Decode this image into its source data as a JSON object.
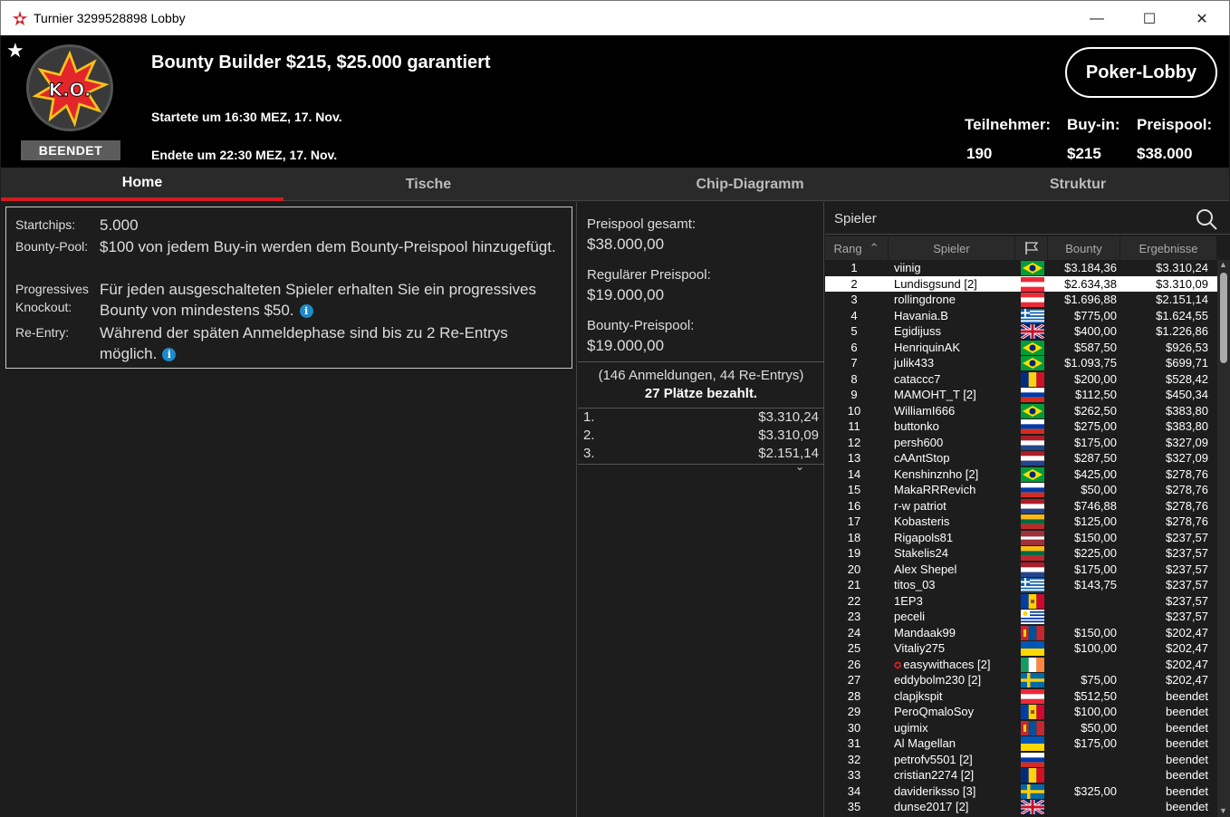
{
  "window": {
    "title": "Turnier 3299528898 Lobby",
    "min": "—",
    "max": "☐",
    "close": "✕"
  },
  "header": {
    "status": "BEENDET",
    "name": "Bounty Builder $215, $25.000 garantiert",
    "start": "Startete um 16:30 MEZ, 17. Nov.",
    "end": "Endete um 22:30 MEZ, 17. Nov.",
    "lobby_button": "Poker-Lobby",
    "stats": [
      {
        "label": "Teilnehmer:",
        "value": "190"
      },
      {
        "label": "Buy-in:",
        "value": "$215"
      },
      {
        "label": "Preispool:",
        "value": "$38.000"
      }
    ]
  },
  "tabs": [
    {
      "label": "Home",
      "active": true
    },
    {
      "label": "Tische",
      "active": false
    },
    {
      "label": "Chip-Diagramm",
      "active": false
    },
    {
      "label": "Struktur",
      "active": false
    }
  ],
  "info": {
    "startchips_key": "Startchips:",
    "startchips_val": "5.000",
    "bounty_key": "Bounty-Pool:",
    "bounty_val": "$100 von jedem Buy-in werden dem Bounty-Preispool hinzugefügt.",
    "pko_key1": "Progressives",
    "pko_key2": "Knockout:",
    "pko_val": "Für jeden ausgeschalteten Spieler erhalten Sie ein progressives Bounty von mindestens $50.",
    "reentry_key": "Re-Entry:",
    "reentry_val": "Während der späten Anmeldephase sind bis zu 2 Re-Entrys möglich.",
    "info_glyph": "i"
  },
  "prize": {
    "total_label": "Preispool gesamt:",
    "total_value": "$38.000,00",
    "regular_label": "Regulärer Preispool:",
    "regular_value": "$19.000,00",
    "bounty_label": "Bounty-Preispool:",
    "bounty_value": "$19.000,00",
    "registrations": "(146 Anmeldungen, 44 Re-Entrys)",
    "paid": "27 Plätze bezahlt.",
    "payouts": [
      {
        "place": "1.",
        "amount": "$3.310,24"
      },
      {
        "place": "2.",
        "amount": "$3.310,09"
      },
      {
        "place": "3.",
        "amount": "$2.151,14"
      }
    ]
  },
  "players": {
    "title": "Spieler",
    "columns": {
      "rank": "Rang",
      "player": "Spieler",
      "bounty": "Bounty",
      "result": "Ergebnisse"
    },
    "rows": [
      {
        "rank": "1",
        "name": "viinig",
        "flag": "br",
        "bounty": "$3.184,36",
        "result": "$3.310,24"
      },
      {
        "rank": "2",
        "name": "Lundisgsund [2]",
        "flag": "at",
        "bounty": "$2.634,38",
        "result": "$3.310,09",
        "selected": true
      },
      {
        "rank": "3",
        "name": "rollingdrone",
        "flag": "at",
        "bounty": "$1.696,88",
        "result": "$2.151,14"
      },
      {
        "rank": "4",
        "name": "Havania.B",
        "flag": "gr",
        "bounty": "$775,00",
        "result": "$1.624,55"
      },
      {
        "rank": "5",
        "name": "Egidijuss",
        "flag": "uk",
        "bounty": "$400,00",
        "result": "$1.226,86"
      },
      {
        "rank": "6",
        "name": "HenriquinAK",
        "flag": "br",
        "bounty": "$587,50",
        "result": "$926,53"
      },
      {
        "rank": "7",
        "name": "julik433",
        "flag": "br",
        "bounty": "$1.093,75",
        "result": "$699,71"
      },
      {
        "rank": "8",
        "name": "cataccc7",
        "flag": "ro",
        "bounty": "$200,00",
        "result": "$528,42"
      },
      {
        "rank": "9",
        "name": "MAMOHT_T [2]",
        "flag": "ru",
        "bounty": "$112,50",
        "result": "$450,34"
      },
      {
        "rank": "10",
        "name": "WilliamI666",
        "flag": "br",
        "bounty": "$262,50",
        "result": "$383,80"
      },
      {
        "rank": "11",
        "name": "buttonko",
        "flag": "ru",
        "bounty": "$275,00",
        "result": "$383,80"
      },
      {
        "rank": "12",
        "name": "persh600",
        "flag": "nl",
        "bounty": "$175,00",
        "result": "$327,09"
      },
      {
        "rank": "13",
        "name": "cAAntStop",
        "flag": "nl",
        "bounty": "$287,50",
        "result": "$327,09"
      },
      {
        "rank": "14",
        "name": "Kenshinznho [2]",
        "flag": "br",
        "bounty": "$425,00",
        "result": "$278,76"
      },
      {
        "rank": "15",
        "name": "MakaRRRevich",
        "flag": "ru",
        "bounty": "$50,00",
        "result": "$278,76"
      },
      {
        "rank": "16",
        "name": "r-w patriot",
        "flag": "nl",
        "bounty": "$746,88",
        "result": "$278,76"
      },
      {
        "rank": "17",
        "name": "Kobasteris",
        "flag": "lt",
        "bounty": "$125,00",
        "result": "$278,76"
      },
      {
        "rank": "18",
        "name": "Rigapols81",
        "flag": "lv",
        "bounty": "$150,00",
        "result": "$237,57"
      },
      {
        "rank": "19",
        "name": "Stakelis24",
        "flag": "lt",
        "bounty": "$225,00",
        "result": "$237,57"
      },
      {
        "rank": "20",
        "name": "Alex Shepel",
        "flag": "nl",
        "bounty": "$175,00",
        "result": "$237,57"
      },
      {
        "rank": "21",
        "name": "titos_03",
        "flag": "gr",
        "bounty": "$143,75",
        "result": "$237,57"
      },
      {
        "rank": "22",
        "name": "1EP3",
        "flag": "md",
        "bounty": "",
        "result": "$237,57"
      },
      {
        "rank": "23",
        "name": "peceli",
        "flag": "uy",
        "bounty": "",
        "result": "$237,57"
      },
      {
        "rank": "24",
        "name": "Mandaak99",
        "flag": "mn",
        "bounty": "$150,00",
        "result": "$202,47"
      },
      {
        "rank": "25",
        "name": "Vitaliy275",
        "flag": "ua",
        "bounty": "$100,00",
        "result": "$202,47"
      },
      {
        "rank": "26",
        "name": "easywithaces [2]",
        "flag": "ie",
        "bounty": "",
        "result": "$202,47",
        "star": true
      },
      {
        "rank": "27",
        "name": "eddybolm230 [2]",
        "flag": "se",
        "bounty": "$75,00",
        "result": "$202,47"
      },
      {
        "rank": "28",
        "name": "clapjkspit",
        "flag": "at",
        "bounty": "$512,50",
        "result": "beendet"
      },
      {
        "rank": "29",
        "name": "PeroQmaloSoy",
        "flag": "md",
        "bounty": "$100,00",
        "result": "beendet"
      },
      {
        "rank": "30",
        "name": "ugimix",
        "flag": "mn",
        "bounty": "$50,00",
        "result": "beendet"
      },
      {
        "rank": "31",
        "name": "Al Magellan",
        "flag": "ua",
        "bounty": "$175,00",
        "result": "beendet"
      },
      {
        "rank": "32",
        "name": "petrofv5501 [2]",
        "flag": "ru",
        "bounty": "",
        "result": "beendet"
      },
      {
        "rank": "33",
        "name": "cristian2274 [2]",
        "flag": "ro",
        "bounty": "",
        "result": "beendet"
      },
      {
        "rank": "34",
        "name": "davideriksso [3]",
        "flag": "se",
        "bounty": "$325,00",
        "result": "beendet"
      },
      {
        "rank": "35",
        "name": "dunse2017 [2]",
        "flag": "uk",
        "bounty": "",
        "result": "beendet"
      }
    ]
  },
  "colors": {
    "accent": "#d21b24",
    "header_bg": "#000000",
    "panel_bg": "#1d1d1d",
    "info_blue": "#1f8ac8"
  }
}
